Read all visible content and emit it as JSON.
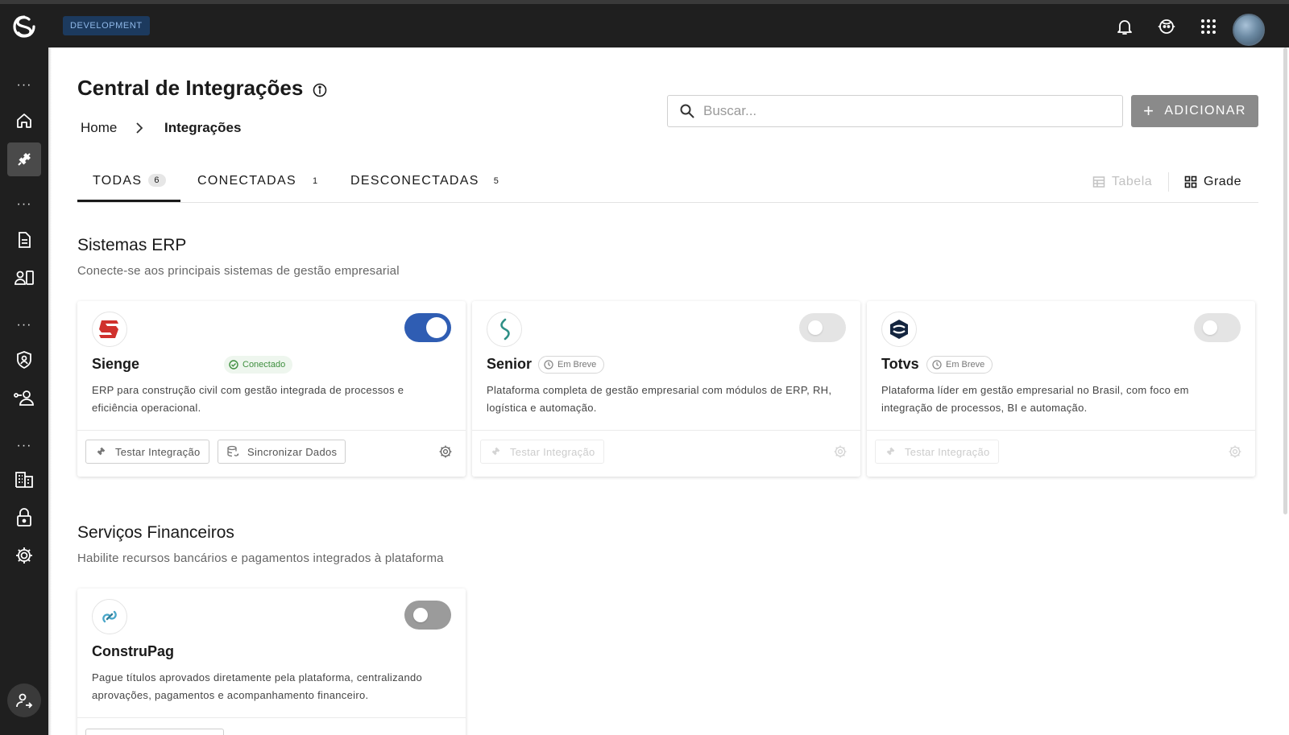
{
  "app": {
    "environment": "DEVELOPMENT"
  },
  "header": {
    "icons": [
      "bell-icon",
      "support-agent-icon",
      "apps-grid-icon"
    ],
    "avatar": "user-avatar"
  },
  "sidebar": {
    "items": [
      "home-icon",
      "integrations-icon",
      "document-icon",
      "contacts-icon",
      "shield-icon",
      "users-icon",
      "building-icon",
      "lock-icon",
      "gear-icon"
    ],
    "footer_item": "account-icon"
  },
  "page": {
    "title": "Central de Integrações",
    "breadcrumb": {
      "home": "Home",
      "current": "Integrações"
    }
  },
  "search": {
    "placeholder": "Buscar..."
  },
  "toolbar": {
    "add_label": "ADICIONAR"
  },
  "tabs": [
    {
      "label": "TODAS",
      "count": "6",
      "active": true
    },
    {
      "label": "CONECTADAS",
      "count": "1",
      "active": false
    },
    {
      "label": "DESCONECTADAS",
      "count": "5",
      "active": false
    }
  ],
  "view_toggle": {
    "table_label": "Tabela",
    "grid_label": "Grade",
    "selected": "Grade"
  },
  "sections": [
    {
      "title": "Sistemas ERP",
      "subtitle": "Conecte-se aos principais sistemas de gestão empresarial",
      "cards": [
        {
          "name": "Sienge",
          "status": "Conectado",
          "enabled": true,
          "description": "ERP para construção civil com gestão integrada de processos e eficiência operacional.",
          "actions": [
            "Testar Integração",
            "Sincronizar Dados"
          ]
        },
        {
          "name": "Senior",
          "status": "Em Breve",
          "enabled": false,
          "description": "Plataforma completa de gestão empresarial com módulos de ERP, RH, logística e automação.",
          "actions": [
            "Testar Integração"
          ]
        },
        {
          "name": "Totvs",
          "status": "Em Breve",
          "enabled": false,
          "description": "Plataforma líder em gestão empresarial no Brasil, com foco em integração de processos, BI e automação.",
          "actions": [
            "Testar Integração"
          ]
        }
      ]
    },
    {
      "title": "Serviços Financeiros",
      "subtitle": "Habilite recursos bancários e pagamentos integrados à plataforma",
      "cards": [
        {
          "name": "ConstruPag",
          "status": "",
          "enabled": false,
          "description": "Pague títulos aprovados diretamente pela plataforma, centralizando aprovações, pagamentos e acompanhamento financeiro."
        }
      ]
    }
  ],
  "colors": {
    "topbar": "#1f1f1f",
    "toggle_on": "#2f5db3",
    "connected": "#3f8f3f",
    "sienge_red": "#d0312d",
    "senior_teal": "#2f8f86",
    "totvs_navy": "#14253f"
  }
}
